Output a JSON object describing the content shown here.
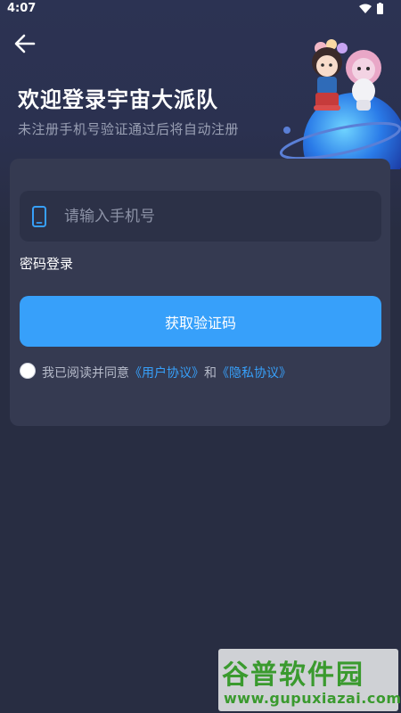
{
  "status_bar": {
    "time": "4:07",
    "icons": [
      "wifi-icon",
      "battery-icon"
    ]
  },
  "header": {
    "back_icon": "arrow-left-icon",
    "title": "欢迎登录宇宙大派队",
    "subtitle": "未注册手机号验证通过后将自动注册"
  },
  "login_form": {
    "phone_field": {
      "icon": "phone-icon",
      "value": "",
      "placeholder": "请输入手机号"
    },
    "password_login_label": "密码登录",
    "get_code_button_label": "获取验证码",
    "agreement": {
      "checked": false,
      "prefix": "我已阅读并同意",
      "user_agreement_link": "《用户协议》",
      "connector": "和",
      "privacy_link": "《隐私协议》"
    }
  },
  "watermark": {
    "logo_text": "谷普软件园",
    "url": "www.gupuxiazai.com"
  },
  "colors": {
    "background": "#282d42",
    "card": "#353a51",
    "input": "#2c3147",
    "accent": "#37a0fa",
    "subtitle": "#9aa0b4"
  }
}
